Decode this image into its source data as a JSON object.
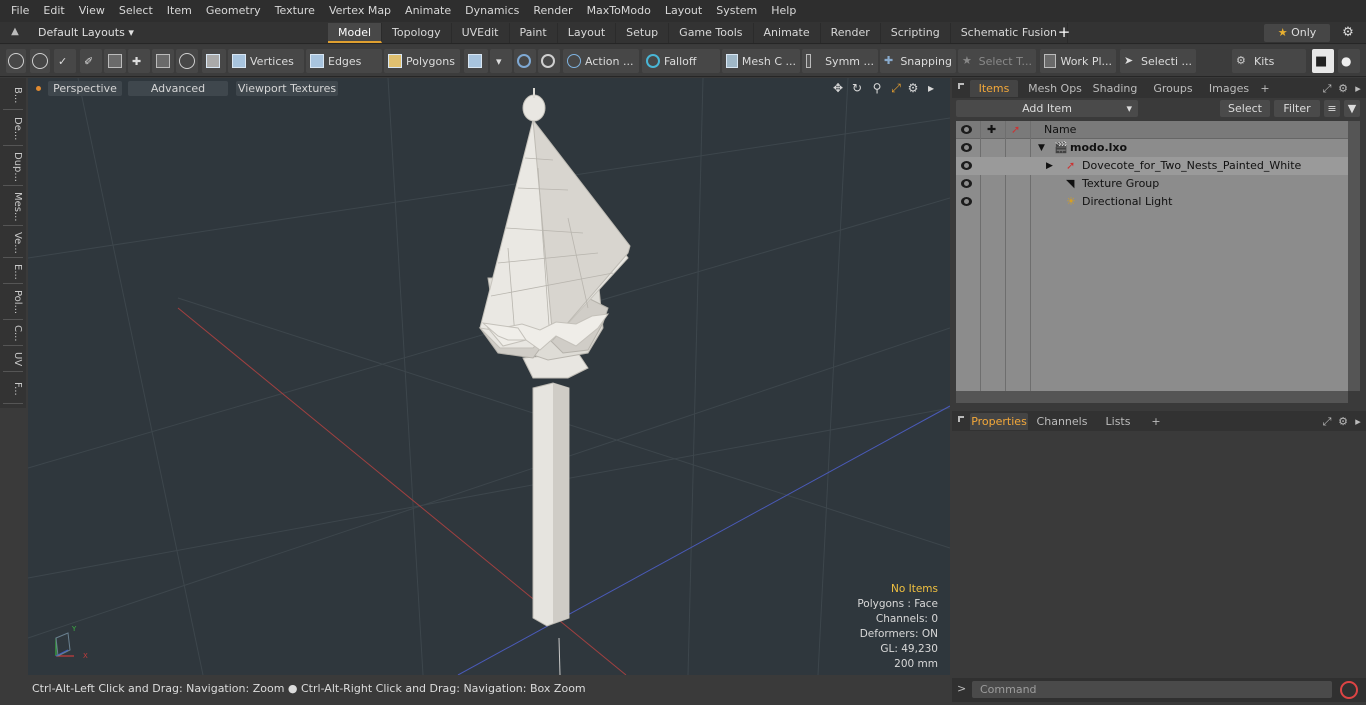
{
  "menubar": [
    "File",
    "Edit",
    "View",
    "Select",
    "Item",
    "Geometry",
    "Texture",
    "Vertex Map",
    "Animate",
    "Dynamics",
    "Render",
    "MaxToModo",
    "Layout",
    "System",
    "Help"
  ],
  "layout": {
    "name": "Default Layouts"
  },
  "tabs": [
    "Model",
    "Topology",
    "UVEdit",
    "Paint",
    "Layout",
    "Setup",
    "Game Tools",
    "Animate",
    "Render",
    "Scripting",
    "Schematic Fusion"
  ],
  "active_tab": "Model",
  "only_label": "Only",
  "toolbar": {
    "vertices": "Vertices",
    "edges": "Edges",
    "polygons": "Polygons",
    "action": "Action ...",
    "falloff": "Falloff",
    "mesh": "Mesh C ...",
    "symm": "Symm ...",
    "snapping": "Snapping",
    "select_t": "Select T...",
    "work_pl": "Work Pl...",
    "selecti": "Selecti ...",
    "kits": "Kits"
  },
  "left_tabs": [
    "B...",
    "De...",
    "Dup...",
    "Mes...",
    "Ve...",
    "E...",
    "Pol...",
    "C...",
    "UV",
    "F..."
  ],
  "viewport": {
    "perspective": "Perspective",
    "advanced": "Advanced",
    "textures": "Viewport Textures",
    "info": {
      "no_items": "No Items",
      "polygons": "Polygons : Face",
      "channels": "Channels: 0",
      "deformers": "Deformers: ON",
      "gl": "GL: 49,230",
      "scale": "200 mm"
    }
  },
  "status": "Ctrl-Alt-Left Click and Drag: Navigation: Zoom ● Ctrl-Alt-Right Click and Drag: Navigation: Box Zoom",
  "right_tabs": [
    "Items",
    "Mesh Ops",
    "Shading",
    "Groups",
    "Images"
  ],
  "items_toolbar": {
    "add_item": "Add Item",
    "select": "Select",
    "filter": "Filter"
  },
  "items_header": {
    "name": "Name"
  },
  "items": [
    {
      "label": "modo.lxo"
    },
    {
      "label": "Dovecote_for_Two_Nests_Painted_White"
    },
    {
      "label": "Texture Group"
    },
    {
      "label": "Directional Light"
    }
  ],
  "prop_tabs": [
    "Properties",
    "Channels",
    "Lists"
  ],
  "command": {
    "placeholder": "Command"
  },
  "colors": {
    "accent": "#f3a83a",
    "viewport_bg": "#2f373d",
    "model": "#e8e6e1"
  }
}
